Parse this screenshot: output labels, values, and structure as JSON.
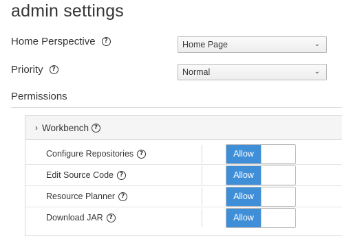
{
  "page": {
    "title": "admin settings"
  },
  "home_perspective": {
    "label": "Home Perspective",
    "selected": "Home Page"
  },
  "priority": {
    "label": "Priority",
    "selected": "Normal"
  },
  "permissions": {
    "label": "Permissions",
    "section_title": "Workbench",
    "rows": [
      {
        "label": "Configure Repositories",
        "toggle_label": "Allow"
      },
      {
        "label": "Edit Source Code",
        "toggle_label": "Allow"
      },
      {
        "label": "Resource Planner",
        "toggle_label": "Allow"
      },
      {
        "label": "Download JAR",
        "toggle_label": "Allow"
      }
    ]
  },
  "icons": {
    "help": "question-circle-icon",
    "chevron_down": "chevron-down-icon",
    "chevron_right": "chevron-right-icon"
  },
  "colors": {
    "toggle_on": "#3f8ed8"
  }
}
